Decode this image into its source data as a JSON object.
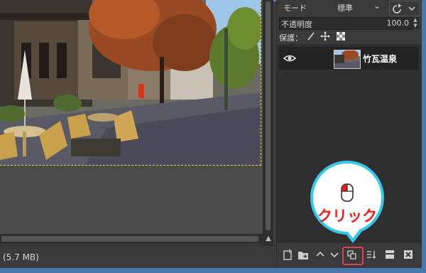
{
  "canvas": {
    "status_text": "(5.7 MB)"
  },
  "panel": {
    "mode_label": "モード",
    "mode_value": "標準",
    "opacity_label": "不透明度",
    "opacity_value": "100.0",
    "lock_label": "保護："
  },
  "layers": [
    {
      "name": "竹瓦温泉",
      "visible": true
    }
  ],
  "callout": {
    "text": "クリック",
    "border_color": "#38c7ea",
    "text_color": "#e52020"
  },
  "highlight_color": "#e43f5a"
}
